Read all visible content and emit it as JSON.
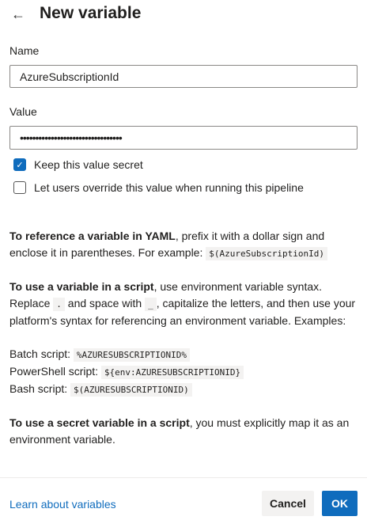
{
  "header": {
    "back_icon": "arrow-left-icon",
    "title": "New variable"
  },
  "form": {
    "name_label": "Name",
    "name_value": "AzureSubscriptionId",
    "value_label": "Value",
    "value_masked": "•••••••••••••••••••••••••••••••••",
    "keep_secret": {
      "label": "Keep this value secret",
      "checked": true
    },
    "allow_override": {
      "label": "Let users override this value when running this pipeline",
      "checked": false
    }
  },
  "help": {
    "yaml_bold": "To reference a variable in YAML",
    "yaml_text": ", prefix it with a dollar sign and enclose it in parentheses. For example: ",
    "yaml_code": "$(AzureSubscriptionId)",
    "script_bold": "To use a variable in a script",
    "script_text1": ", use environment variable syntax. Replace ",
    "script_code_dot": ".",
    "script_text2": " and space with ",
    "script_code_us": "_",
    "script_text3": ", capitalize the letters, and then use your platform's syntax for referencing an environment variable. Examples:",
    "batch_label": "Batch script: ",
    "batch_code": "%AZURESUBSCRIPTIONID%",
    "ps_label": "PowerShell script: ",
    "ps_code": "${env:AZURESUBSCRIPTIONID}",
    "bash_label": "Bash script: ",
    "bash_code": "$(AZURESUBSCRIPTIONID)",
    "secret_bold": "To use a secret variable in a script",
    "secret_text": ", you must explicitly map it as an environment variable."
  },
  "footer": {
    "link": "Learn about variables",
    "cancel": "Cancel",
    "ok": "OK"
  },
  "colors": {
    "accent": "#0f6cbd"
  }
}
